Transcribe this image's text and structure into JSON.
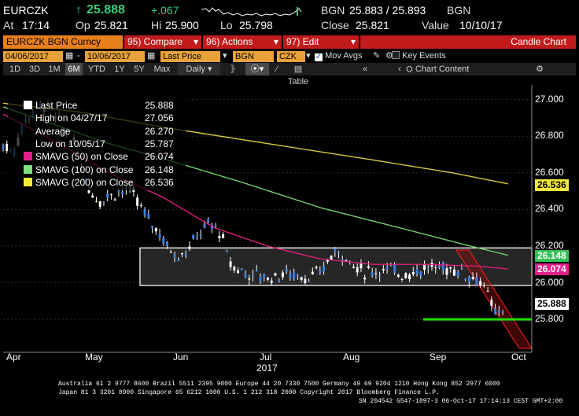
{
  "header": {
    "ticker": "EURCZK",
    "arrow": "↑",
    "last": "25.888",
    "change": "+.067",
    "source": "BGN",
    "bid_ask": "25.883 / 25.893",
    "source2": "BGN",
    "at_label": "At",
    "time": "17:14",
    "open_label": "Op",
    "open": "25.821",
    "high_label": "Hi",
    "high": "25.900",
    "low_label": "Lo",
    "low": "25.798",
    "close_label": "Close",
    "close": "25.821",
    "value_label": "Value",
    "value_date": "10/10/17"
  },
  "toolbar1": {
    "security": "EURCZK BGN Curncy",
    "compare": "95) Compare",
    "actions": "96) Actions",
    "edit": "97) Edit",
    "chart_type": "Candle Chart"
  },
  "toolbar2": {
    "start_date": "04/06/2017",
    "end_date": "10/06/2017",
    "price_field": "Last Price",
    "source": "BGN",
    "currency": "CZK",
    "mov_avgs": "Mov Avgs",
    "key_events": "Key Events"
  },
  "toolbar3": {
    "ranges": [
      "1D",
      "3D",
      "1M",
      "6M",
      "YTD",
      "1Y",
      "5Y",
      "Max"
    ],
    "selected": "6M",
    "period": "Daily",
    "table": "Table",
    "chart_content": "Chart Content"
  },
  "legend": [
    {
      "label": "Last Price",
      "value": "25.888",
      "color": "#ffffff"
    },
    {
      "label": "High on 04/27/17",
      "value": "27.056",
      "color": ""
    },
    {
      "label": "Average",
      "value": "26.270",
      "color": ""
    },
    {
      "label": "Low on 10/05/17",
      "value": "25.787",
      "color": ""
    },
    {
      "label": "SMAVG (50) on Close",
      "value": "26.074",
      "color": "#e0218a"
    },
    {
      "label": "SMAVG (100) on Close",
      "value": "26.148",
      "color": "#7ee07e"
    },
    {
      "label": "SMAVG (200) on Close",
      "value": "26.536",
      "color": "#f2ea3a"
    }
  ],
  "chart_data": {
    "type": "candlestick",
    "ylim": [
      25.62,
      27.08
    ],
    "y_ticks": [
      "27.000",
      "26.800",
      "26.600",
      "26.400",
      "26.200",
      "26.000",
      "25.800"
    ],
    "x_ticks": [
      "Apr",
      "May",
      "Jun",
      "Jul",
      "Aug",
      "Sep",
      "Oct"
    ],
    "x_year": "2017",
    "right_tags": [
      {
        "value": "26.536",
        "numeric": 26.536,
        "color": "#f2ea3a",
        "text_color": "#000"
      },
      {
        "value": "26.148",
        "numeric": 26.148,
        "color": "#36c15a",
        "text_color": "#fff"
      },
      {
        "value": "26.074",
        "numeric": 26.074,
        "color": "#e0218a",
        "text_color": "#fff"
      },
      {
        "value": "25.888",
        "numeric": 25.888,
        "color": "#ffffff",
        "text_color": "#000"
      }
    ],
    "series": [
      {
        "name": "SMAVG (200) on Close",
        "color": "#d9c93a",
        "values": [
          [
            0,
            26.98
          ],
          [
            0.15,
            26.93
          ],
          [
            0.3,
            26.85
          ],
          [
            0.5,
            26.76
          ],
          [
            0.7,
            26.67
          ],
          [
            0.85,
            26.6
          ],
          [
            0.955,
            26.54
          ]
        ]
      },
      {
        "name": "SMAVG (100) on Close",
        "color": "#6fcf6f",
        "values": [
          [
            0,
            26.96
          ],
          [
            0.1,
            26.86
          ],
          [
            0.2,
            26.76
          ],
          [
            0.3,
            26.68
          ],
          [
            0.45,
            26.55
          ],
          [
            0.6,
            26.41
          ],
          [
            0.75,
            26.3
          ],
          [
            0.87,
            26.21
          ],
          [
            0.955,
            26.15
          ]
        ]
      },
      {
        "name": "SMAVG (50) on Close",
        "color": "#d81f7a",
        "values": [
          [
            0,
            26.92
          ],
          [
            0.1,
            26.77
          ],
          [
            0.2,
            26.6
          ],
          [
            0.3,
            26.47
          ],
          [
            0.4,
            26.3
          ],
          [
            0.5,
            26.2
          ],
          [
            0.6,
            26.13
          ],
          [
            0.7,
            26.1
          ],
          [
            0.8,
            26.1
          ],
          [
            0.9,
            26.09
          ],
          [
            0.955,
            26.075
          ]
        ]
      }
    ],
    "channel": {
      "top": 26.19,
      "bottom": 25.985
    },
    "support_level": 25.8
  },
  "footer": {
    "line1": "Australia 61 2 9777 8600 Brazil 5511 2395 9000 Europe 44 20 7330 7500 Germany 49 69 9204 1210 Hong Kong 852 2977 6000",
    "line2": "Japan 81 3 3201 8900        Singapore 65 6212 1000        U.S. 1 212 318 2000              Copyright 2017 Bloomberg Finance L.P.",
    "line3": "SN 204542 G547-1897-3 06-Oct-17 17:14:13 CEST GMT+2:00"
  }
}
